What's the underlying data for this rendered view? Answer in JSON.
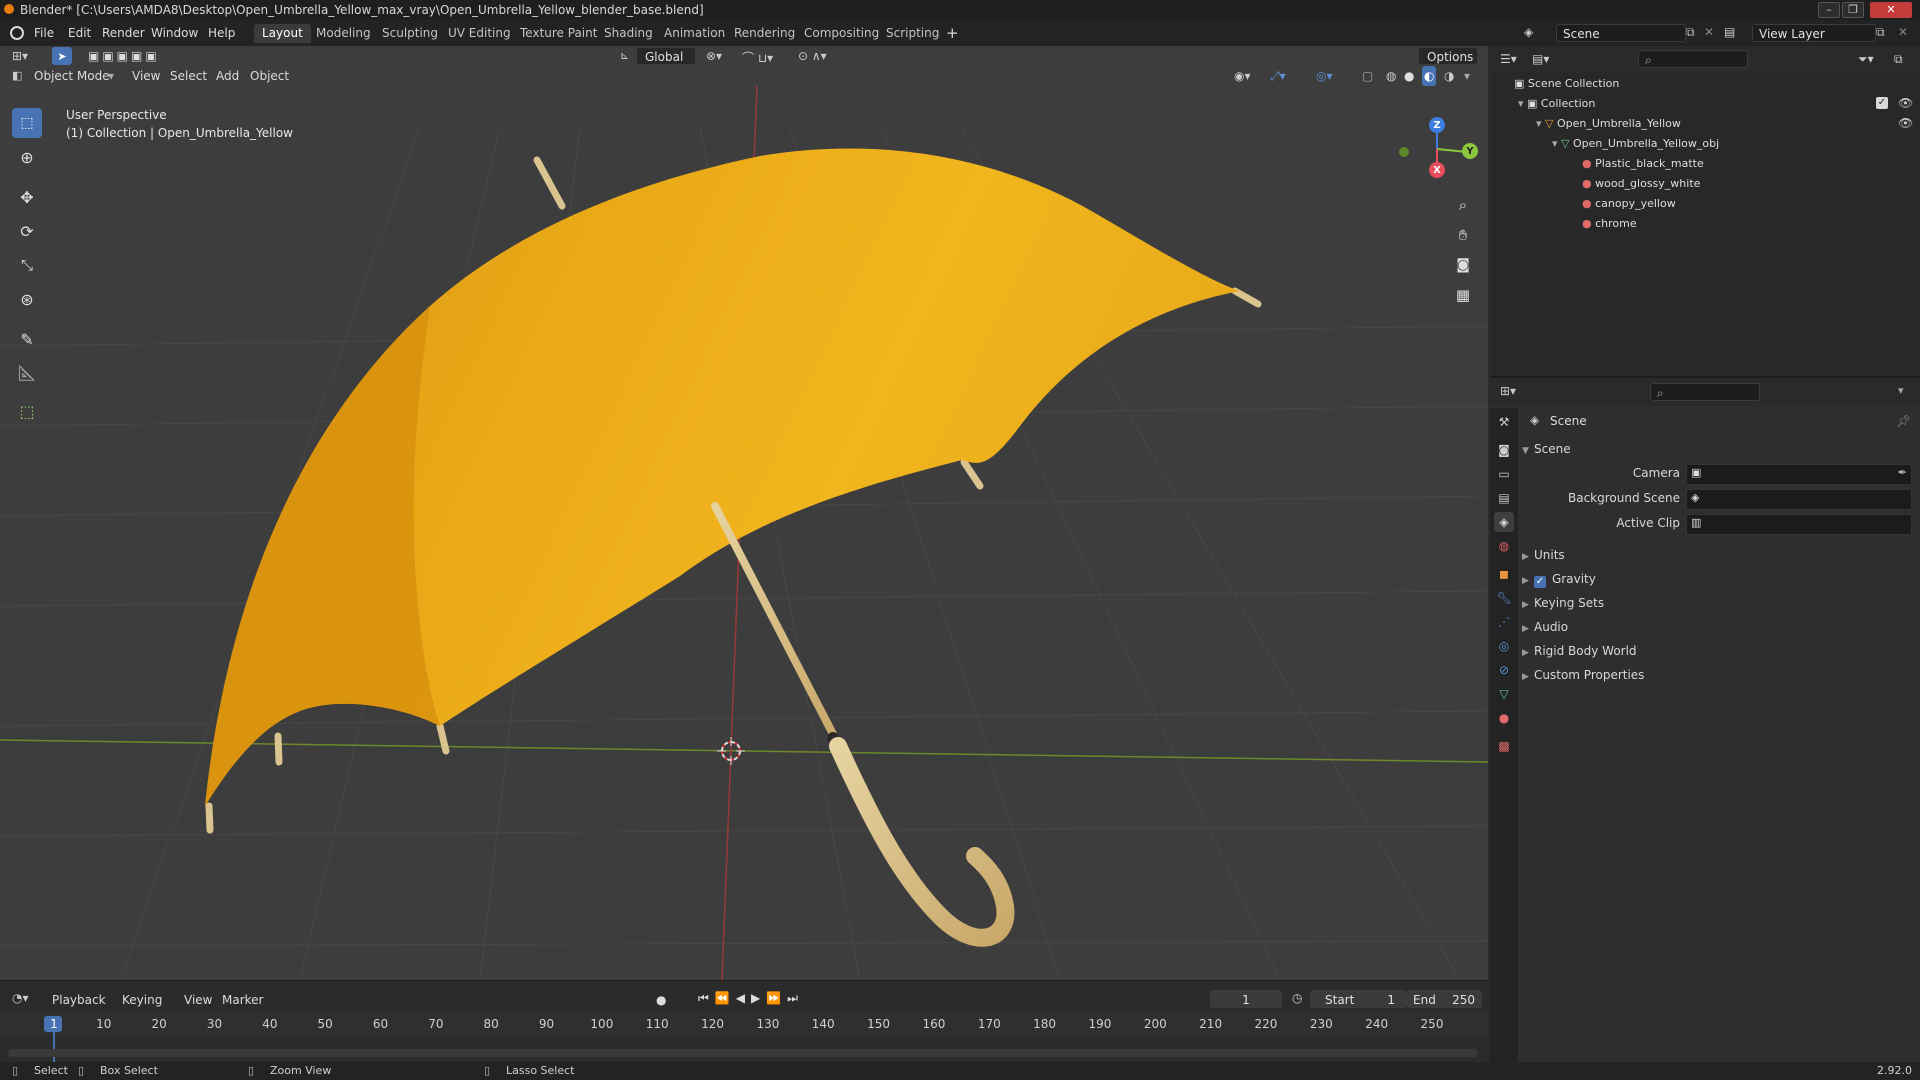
{
  "titlebar": {
    "title": "Blender* [C:\\Users\\AMDA8\\Desktop\\Open_Umbrella_Yellow_max_vray\\Open_Umbrella_Yellow_blender_base.blend]"
  },
  "menubar": {
    "menus": [
      "File",
      "Edit",
      "Render",
      "Window",
      "Help"
    ],
    "workspaces": [
      "Layout",
      "Modeling",
      "Sculpting",
      "UV Editing",
      "Texture Paint",
      "Shading",
      "Animation",
      "Rendering",
      "Compositing",
      "Scripting"
    ],
    "active_workspace": "Layout",
    "scene_name": "Scene",
    "view_layer": "View Layer"
  },
  "viewport": {
    "header": {
      "transform_orientation": "Global",
      "options_label": "Options"
    },
    "mode": "Object Mode",
    "menus": [
      "View",
      "Select",
      "Add",
      "Object"
    ],
    "overlay_text": {
      "perspective": "User Perspective",
      "collection": "(1) Collection | Open_Umbrella_Yellow"
    },
    "gizmo_axes": {
      "z": "Z",
      "y": "Y",
      "x": "X"
    }
  },
  "outliner": {
    "scene_collection": "Scene Collection",
    "rows": [
      {
        "label": "Collection"
      },
      {
        "label": "Open_Umbrella_Yellow"
      },
      {
        "label": "Open_Umbrella_Yellow_obj"
      },
      {
        "label": "Plastic_black_matte"
      },
      {
        "label": "wood_glossy_white"
      },
      {
        "label": "canopy_yellow"
      },
      {
        "label": "chrome"
      }
    ]
  },
  "properties": {
    "header": "Scene",
    "panel": "Scene",
    "fields": [
      {
        "label": "Camera"
      },
      {
        "label": "Background Scene"
      },
      {
        "label": "Active Clip"
      }
    ],
    "subpanels": [
      "Units",
      "Gravity",
      "Keying Sets",
      "Audio",
      "Rigid Body World",
      "Custom Properties"
    ],
    "gravity_enabled": true
  },
  "timeline": {
    "menus": [
      "Playback",
      "Keying",
      "View",
      "Marker"
    ],
    "current_frame": "1",
    "start_label": "Start",
    "start": "1",
    "end_label": "End",
    "end": "250",
    "frame_ticks": [
      "1",
      "10",
      "20",
      "30",
      "40",
      "50",
      "60",
      "70",
      "80",
      "90",
      "100",
      "110",
      "120",
      "130",
      "140",
      "150",
      "160",
      "170",
      "180",
      "190",
      "200",
      "210",
      "220",
      "230",
      "240",
      "250"
    ]
  },
  "statusbar": {
    "select": "Select",
    "box_select": "Box Select",
    "zoom_view": "Zoom View",
    "lasso_select": "Lasso Select",
    "version": "2.92.0"
  },
  "colors": {
    "accent": "#4772b3",
    "canopy": "#e7a812",
    "wood": "#d8c08a",
    "x_axis": "#e74c5c",
    "y_axis": "#8cc63f",
    "z_axis": "#3d7ee0"
  }
}
